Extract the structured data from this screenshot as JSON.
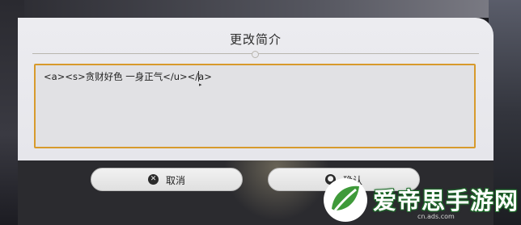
{
  "dialog": {
    "title": "更改简介",
    "textarea_value": "<a><s>贪财好色 一身正气</u></a>"
  },
  "buttons": {
    "cancel": {
      "label": "取消",
      "icon": "x-circle-icon"
    },
    "confirm": {
      "label": "确认",
      "icon": "circle-icon"
    }
  },
  "watermark": {
    "text": "爱帝思手游网",
    "url": "cn.ads.com"
  },
  "colors": {
    "accent_border": "#d79a2c",
    "dialog_bg": "#e8e8ec",
    "footer_bg": "#2b2b2f",
    "watermark_green": "#3f9a3a"
  }
}
